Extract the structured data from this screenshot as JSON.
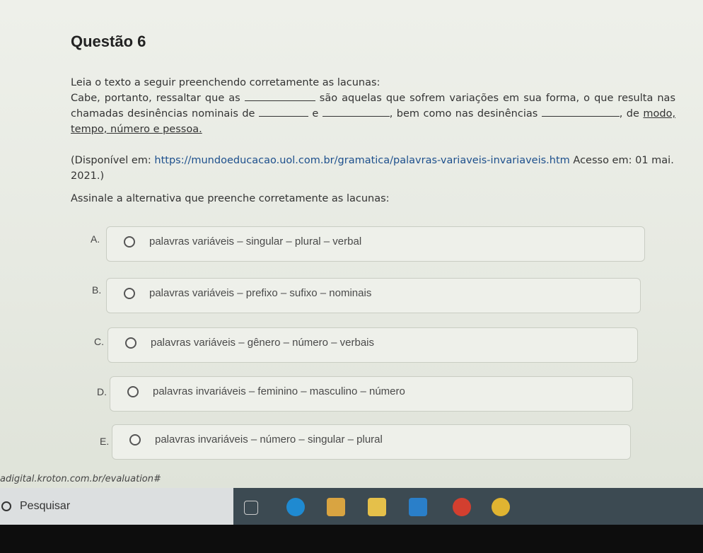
{
  "question": {
    "title": "Questão 6",
    "intro": "Leia o texto a seguir preenchendo corretamente as lacunas:",
    "para_part1": "Cabe, portanto, ressaltar que as",
    "para_part2": "são aquelas que sofrem variações em sua forma, o que resulta nas chamadas desinências nominais de",
    "para_part3": "e",
    "para_part4": ", bem como nas desinências",
    "para_part5": ", de",
    "para_part6": "modo, tempo, número e pessoa.",
    "source_prefix": "(Disponível em:",
    "source_url": "https://mundoeducacao.uol.com.br/gramatica/palavras-variaveis-invariaveis.htm",
    "source_suffix": "Acesso em: 01 mai. 2021.)",
    "prompt": "Assinale a alternativa que preenche corretamente as lacunas:"
  },
  "options": [
    {
      "letter": "A.",
      "label": "palavras variáveis – singular – plural – verbal"
    },
    {
      "letter": "B.",
      "label": "palavras variáveis – prefixo – sufixo – nominais"
    },
    {
      "letter": "C.",
      "label": "palavras variáveis – gênero – número – verbais"
    },
    {
      "letter": "D.",
      "label": "palavras invariáveis – feminino – masculino – número"
    },
    {
      "letter": "E.",
      "label": "palavras invariáveis – número – singular – plural"
    }
  ],
  "status_url": "adigital.kroton.com.br/evaluation#",
  "taskbar": {
    "search_label": "Pesquisar"
  },
  "colors": {
    "taskbar": "#3c4a52",
    "link": "#1d4f8c"
  }
}
